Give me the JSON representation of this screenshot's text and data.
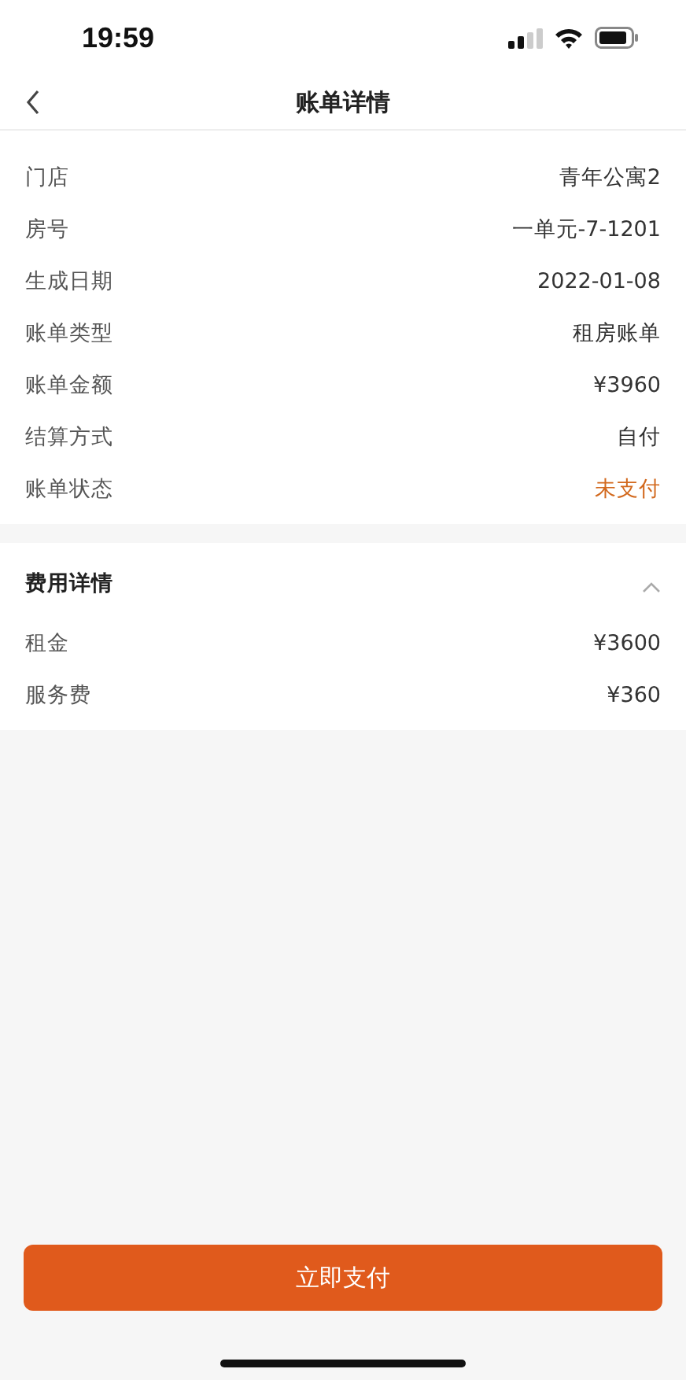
{
  "status_bar": {
    "time": "19:59"
  },
  "nav": {
    "title": "账单详情"
  },
  "details": [
    {
      "label": "门店",
      "value": "青年公寓2",
      "highlighted": false
    },
    {
      "label": "房号",
      "value": "一单元-7-1201",
      "highlighted": false
    },
    {
      "label": "生成日期",
      "value": "2022-01-08",
      "highlighted": false
    },
    {
      "label": "账单类型",
      "value": "租房账单",
      "highlighted": false
    },
    {
      "label": "账单金额",
      "value": "¥3960",
      "highlighted": false
    },
    {
      "label": "结算方式",
      "value": "自付",
      "highlighted": false
    },
    {
      "label": "账单状态",
      "value": "未支付",
      "highlighted": true
    }
  ],
  "fees": {
    "title": "费用详情",
    "expanded": true,
    "items": [
      {
        "label": "租金",
        "value": "¥3600"
      },
      {
        "label": "服务费",
        "value": "¥360"
      }
    ]
  },
  "pay_button": "立即支付"
}
